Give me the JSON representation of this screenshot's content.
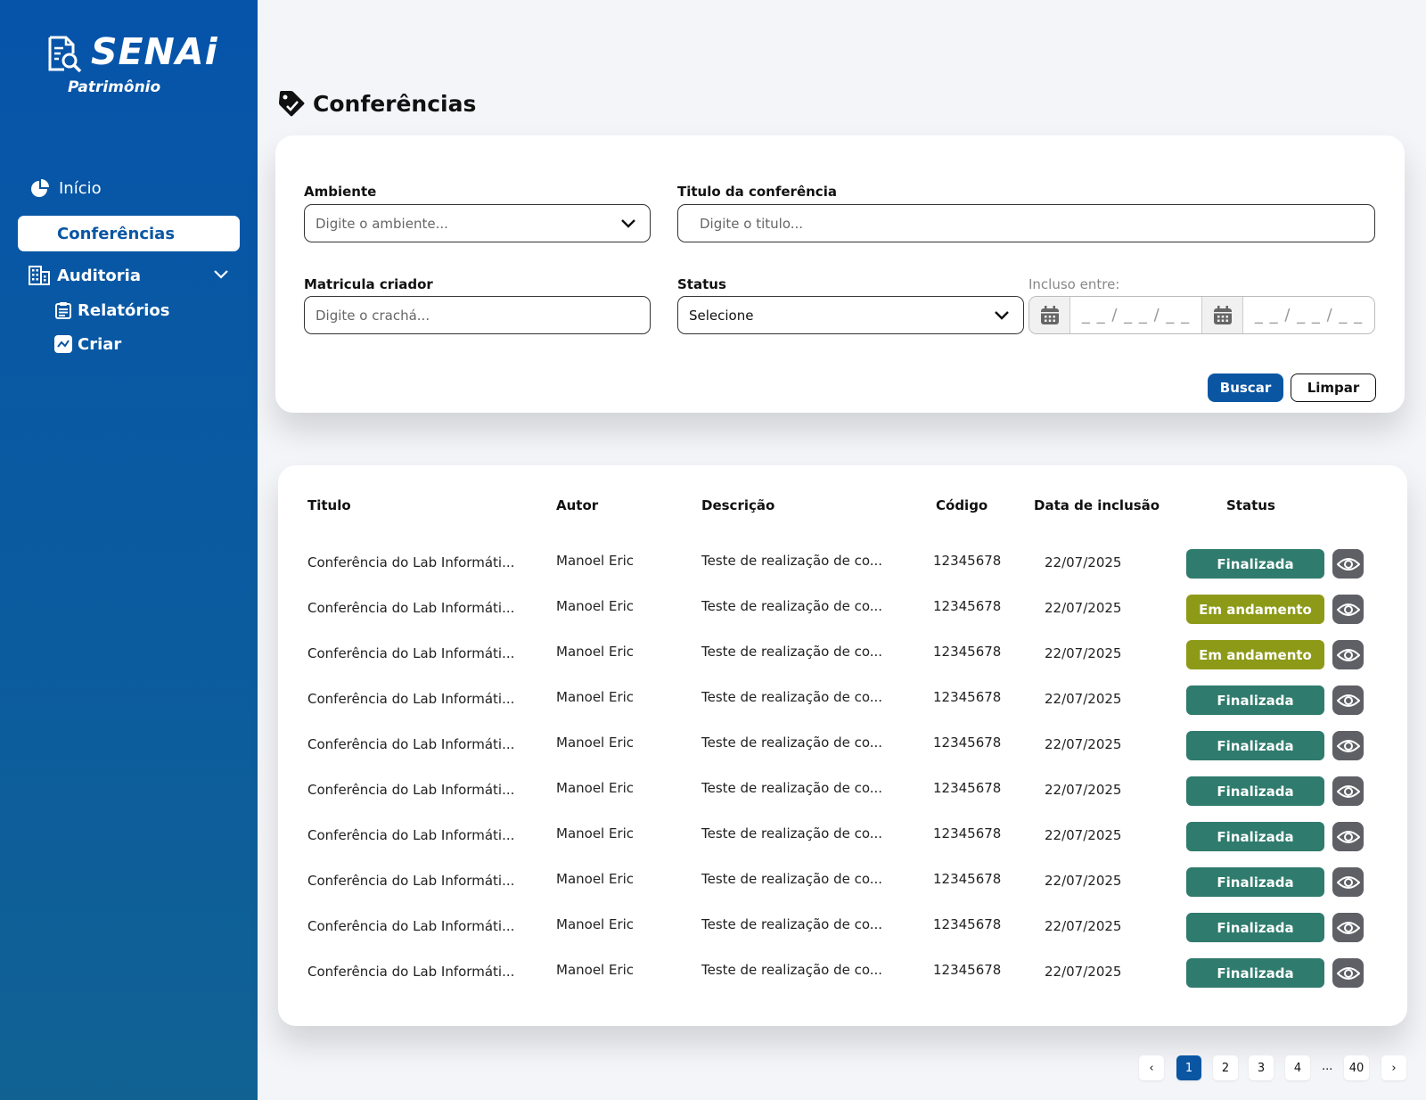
{
  "brand": {
    "name": "SENAi",
    "subtitle": "Patrimônio"
  },
  "sidebar": {
    "items": [
      {
        "label": "Início"
      },
      {
        "label": "Conferências"
      },
      {
        "label": "Auditoria"
      },
      {
        "label": "Relatórios"
      },
      {
        "label": "Criar"
      }
    ]
  },
  "page": {
    "title": "Conferências"
  },
  "filters": {
    "ambiente": {
      "label": "Ambiente",
      "placeholder": "Digite o ambiente..."
    },
    "titulo": {
      "label": "Titulo da conferência",
      "placeholder": "Digite o titulo..."
    },
    "matricula": {
      "label": "Matricula criador",
      "placeholder": "Digite o crachá..."
    },
    "status": {
      "label": "Status",
      "value": "Selecione"
    },
    "incluso": {
      "label": "Incluso entre:",
      "date_placeholder": "_ _ / _ _ / _ _"
    },
    "buscar_label": "Buscar",
    "limpar_label": "Limpar"
  },
  "table": {
    "headers": [
      "Titulo",
      "Autor",
      "Descrição",
      "Código",
      "Data de inclusão",
      "Status"
    ],
    "rows": [
      {
        "titulo": "Conferência do Lab Informáti...",
        "autor": "Manoel Eric",
        "descricao": "Teste de realização de co...",
        "codigo": "12345678",
        "data": "22/07/2025",
        "status": "Finalizada"
      },
      {
        "titulo": "Conferência do Lab Informáti...",
        "autor": "Manoel Eric",
        "descricao": "Teste de realização de co...",
        "codigo": "12345678",
        "data": "22/07/2025",
        "status": "Em andamento"
      },
      {
        "titulo": "Conferência do Lab Informáti...",
        "autor": "Manoel Eric",
        "descricao": "Teste de realização de co...",
        "codigo": "12345678",
        "data": "22/07/2025",
        "status": "Em andamento"
      },
      {
        "titulo": "Conferência do Lab Informáti...",
        "autor": "Manoel Eric",
        "descricao": "Teste de realização de co...",
        "codigo": "12345678",
        "data": "22/07/2025",
        "status": "Finalizada"
      },
      {
        "titulo": "Conferência do Lab Informáti...",
        "autor": "Manoel Eric",
        "descricao": "Teste de realização de co...",
        "codigo": "12345678",
        "data": "22/07/2025",
        "status": "Finalizada"
      },
      {
        "titulo": "Conferência do Lab Informáti...",
        "autor": "Manoel Eric",
        "descricao": "Teste de realização de co...",
        "codigo": "12345678",
        "data": "22/07/2025",
        "status": "Finalizada"
      },
      {
        "titulo": "Conferência do Lab Informáti...",
        "autor": "Manoel Eric",
        "descricao": "Teste de realização de co...",
        "codigo": "12345678",
        "data": "22/07/2025",
        "status": "Finalizada"
      },
      {
        "titulo": "Conferência do Lab Informáti...",
        "autor": "Manoel Eric",
        "descricao": "Teste de realização de co...",
        "codigo": "12345678",
        "data": "22/07/2025",
        "status": "Finalizada"
      },
      {
        "titulo": "Conferência do Lab Informáti...",
        "autor": "Manoel Eric",
        "descricao": "Teste de realização de co...",
        "codigo": "12345678",
        "data": "22/07/2025",
        "status": "Finalizada"
      },
      {
        "titulo": "Conferência do Lab Informáti...",
        "autor": "Manoel Eric",
        "descricao": "Teste de realização de co...",
        "codigo": "12345678",
        "data": "22/07/2025",
        "status": "Finalizada"
      }
    ]
  },
  "status_colors": {
    "Finalizada": "#2f7b6d",
    "Em andamento": "#8d9a18"
  },
  "colors": {
    "primary": "#0a56a3",
    "eye_button": "#5f6066"
  },
  "pagination": {
    "prev": "‹",
    "pages": [
      "1",
      "2",
      "3",
      "4"
    ],
    "ellipsis": "...",
    "last": "40",
    "next": "›",
    "current": "1"
  }
}
